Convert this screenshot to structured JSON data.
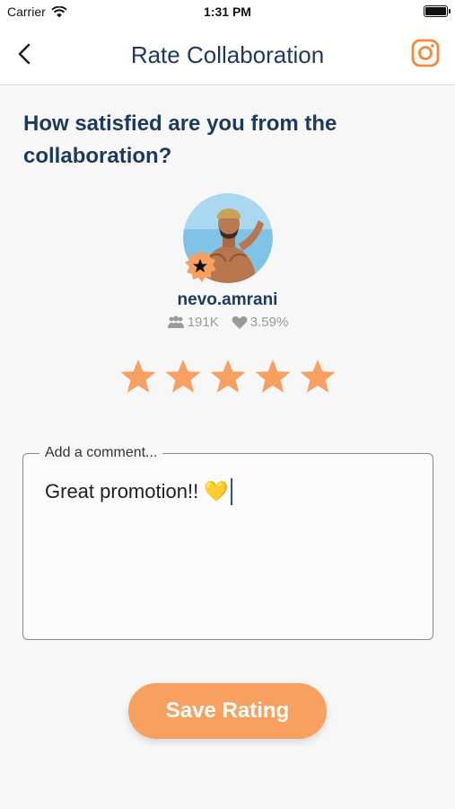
{
  "status_bar": {
    "carrier": "Carrier",
    "time": "1:31 PM"
  },
  "nav": {
    "title": "Rate Collaboration",
    "back_icon": "chevron-left-icon",
    "right_icon": "instagram-icon"
  },
  "question": "How satisfied are you from the collaboration?",
  "profile": {
    "username": "nevo.amrani",
    "followers": "191K",
    "engagement": "3.59%",
    "badge_icon": "star-badge-icon"
  },
  "rating": {
    "value": 5,
    "max": 5
  },
  "comment": {
    "label": "Add a comment...",
    "value": "Great promotion!!",
    "emoji": "💛"
  },
  "save_button": {
    "label": "Save Rating"
  },
  "colors": {
    "accent": "#f7a05f",
    "title": "#1d3a5c",
    "instagram": "#f08a3c"
  }
}
